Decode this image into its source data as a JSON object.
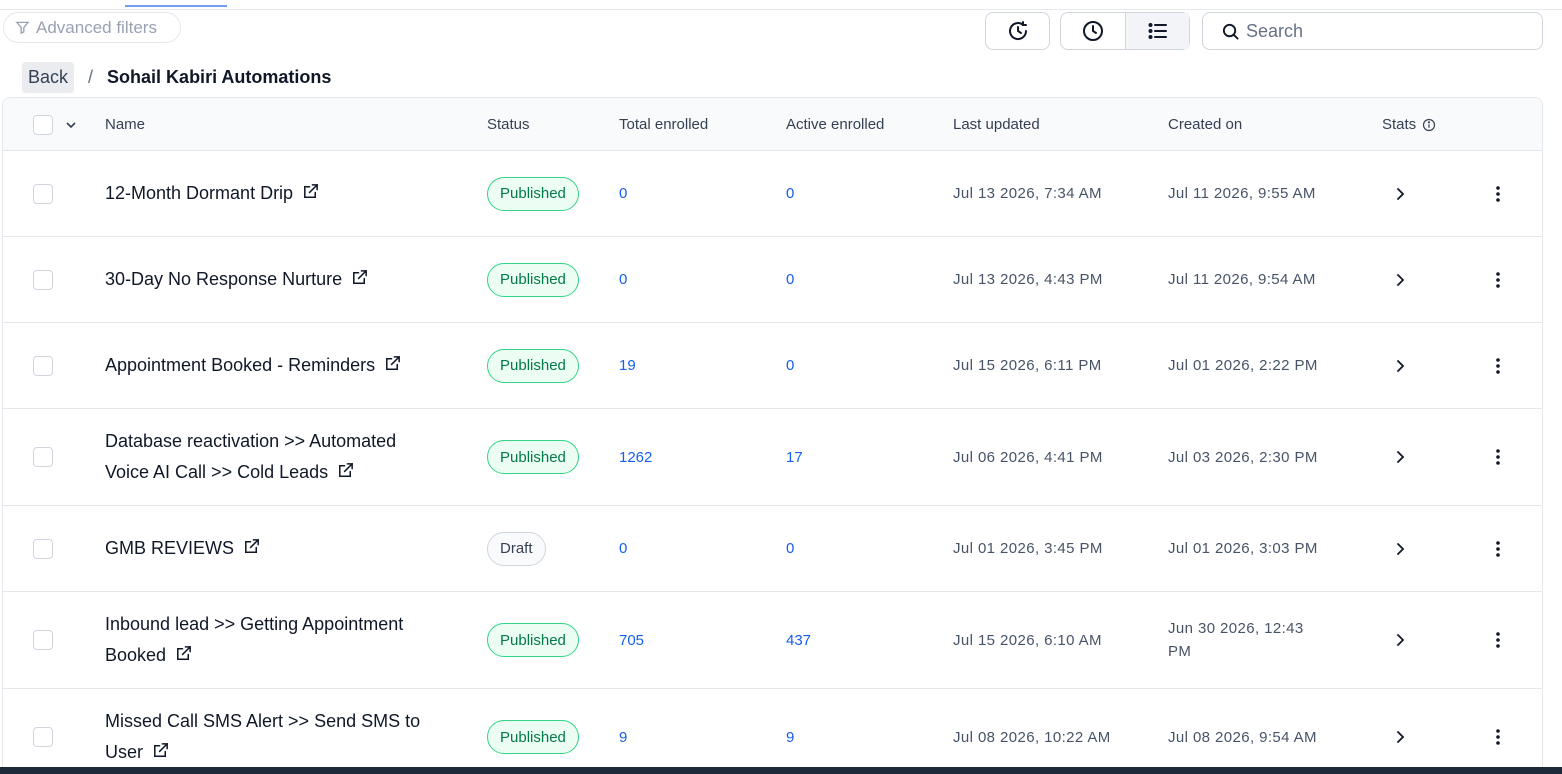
{
  "search": {
    "placeholder": "Search"
  },
  "filters": {
    "label": "Advanced filters"
  },
  "breadcrumb": {
    "back": "Back",
    "separator": "/",
    "title": "Sohail Kabiri Automations"
  },
  "table": {
    "columns": {
      "name": "Name",
      "status": "Status",
      "total": "Total enrolled",
      "active": "Active enrolled",
      "updated": "Last updated",
      "created": "Created on",
      "stats": "Stats"
    },
    "rows": [
      {
        "name": "12-Month Dormant Drip",
        "status": "Published",
        "total": "0",
        "active": "0",
        "updated": "Jul 13 2026, 7:34 AM",
        "created": "Jul 11 2026, 9:55 AM"
      },
      {
        "name": "30-Day No Response Nurture",
        "status": "Published",
        "total": "0",
        "active": "0",
        "updated": "Jul 13 2026, 4:43 PM",
        "created": "Jul 11 2026, 9:54 AM"
      },
      {
        "name": "Appointment Booked - Reminders",
        "status": "Published",
        "total": "19",
        "active": "0",
        "updated": "Jul 15 2026, 6:11 PM",
        "created": "Jul 01 2026, 2:22 PM"
      },
      {
        "name": "Database reactivation >> Automated Voice AI Call >> Cold Leads",
        "status": "Published",
        "total": "1262",
        "active": "17",
        "updated": "Jul 06 2026, 4:41 PM",
        "created": "Jul 03 2026, 2:30 PM"
      },
      {
        "name": "GMB REVIEWS",
        "status": "Draft",
        "total": "0",
        "active": "0",
        "updated": "Jul 01 2026, 3:45 PM",
        "created": "Jul 01 2026, 3:03 PM"
      },
      {
        "name": "Inbound lead >> Getting Appointment Booked",
        "status": "Published",
        "total": "705",
        "active": "437",
        "updated": "Jul 15 2026, 6:10 AM",
        "created": "Jun 30 2026, 12:43 PM"
      },
      {
        "name": "Missed Call SMS Alert >> Send SMS to User",
        "status": "Published",
        "total": "9",
        "active": "9",
        "updated": "Jul 08 2026, 10:22 AM",
        "created": "Jul 08 2026, 9:54 AM"
      }
    ]
  },
  "icons": {
    "filter": "filter-icon",
    "history": "history-icon",
    "clock": "clock-icon",
    "list": "list-view-icon",
    "search": "search-icon",
    "external": "external-link-icon",
    "chevron": "chevron-right-icon",
    "kebab": "kebab-menu-icon",
    "info": "info-icon"
  },
  "colors": {
    "accent": "#155eef",
    "published_bg": "#ecfdf3",
    "published_border": "#32d583",
    "published_text": "#027a48"
  }
}
